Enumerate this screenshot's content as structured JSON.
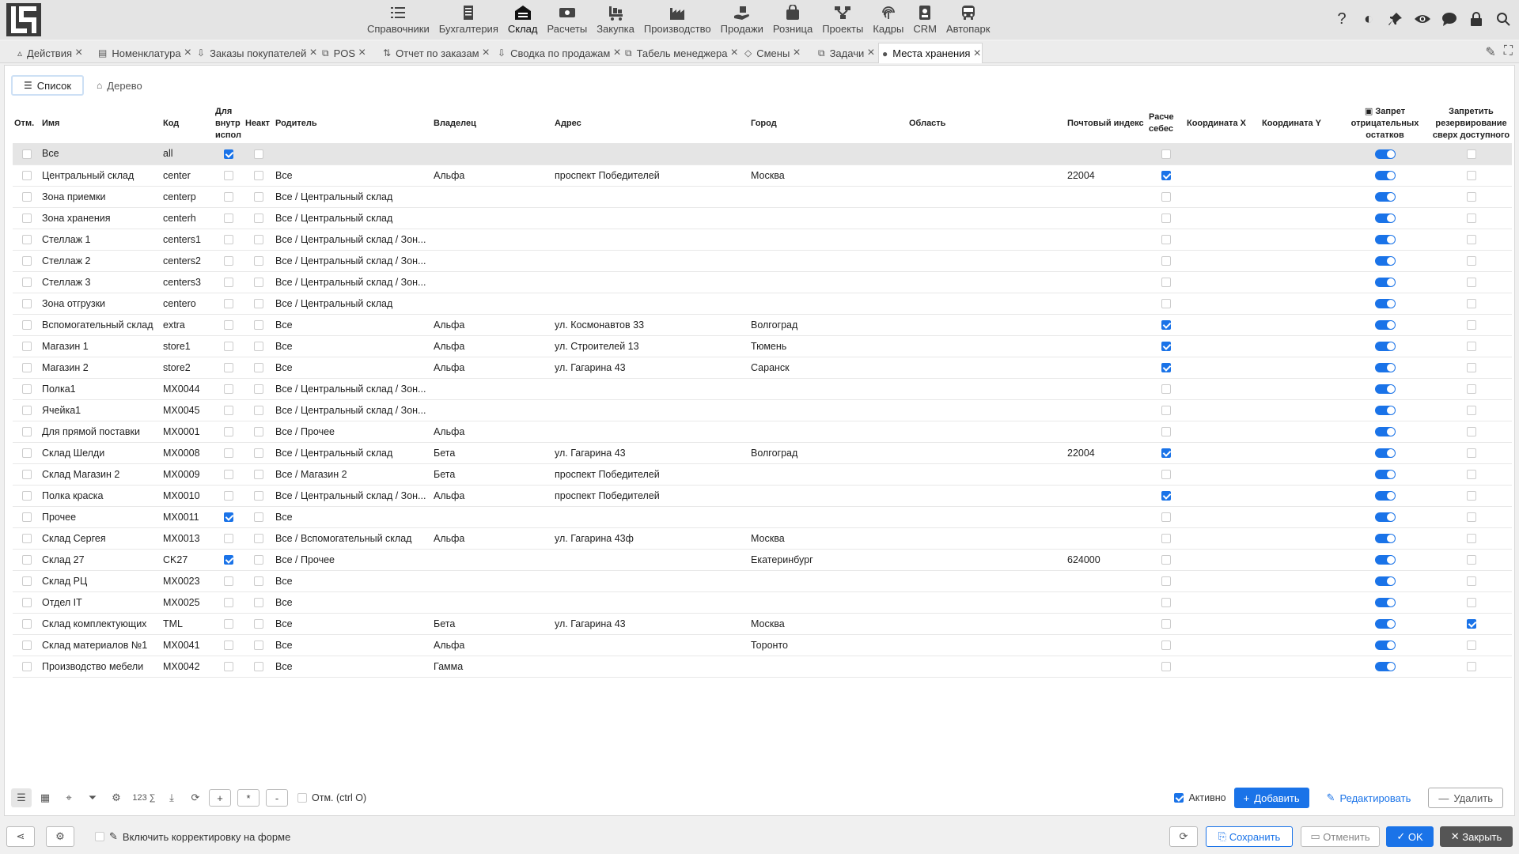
{
  "modules": [
    {
      "label": "Справочники",
      "icon": "list-icon"
    },
    {
      "label": "Бухгалтерия",
      "icon": "ledger-icon"
    },
    {
      "label": "Склад",
      "icon": "warehouse-icon",
      "active": true
    },
    {
      "label": "Расчеты",
      "icon": "money-icon"
    },
    {
      "label": "Закупка",
      "icon": "cart-icon"
    },
    {
      "label": "Производство",
      "icon": "factory-icon"
    },
    {
      "label": "Продажи",
      "icon": "hand-money-icon"
    },
    {
      "label": "Розница",
      "icon": "shopping-bag-icon"
    },
    {
      "label": "Проекты",
      "icon": "project-icon"
    },
    {
      "label": "Кадры",
      "icon": "fingerprint-icon"
    },
    {
      "label": "CRM",
      "icon": "contact-card-icon"
    },
    {
      "label": "Автопарк",
      "icon": "bus-icon"
    }
  ],
  "tabs": [
    {
      "label": "Действия"
    },
    {
      "label": "Номенклатура"
    },
    {
      "label": "Заказы покупателей"
    },
    {
      "label": "POS"
    },
    {
      "label": "Отчет по заказам"
    },
    {
      "label": "Сводка по продажам"
    },
    {
      "label": "Табель менеджера"
    },
    {
      "label": "Смены"
    },
    {
      "label": "Задачи"
    },
    {
      "label": "Места хранения",
      "active": true
    }
  ],
  "view_tabs": {
    "list": "Список",
    "tree": "Дерево"
  },
  "columns": {
    "mark": "Отм.",
    "name": "Имя",
    "code": "Код",
    "internal": "Для внутр испол",
    "inactive": "Неакт",
    "parent": "Родитель",
    "owner": "Владелец",
    "address": "Адрес",
    "city": "Город",
    "region": "Область",
    "postal": "Почтовый индекс",
    "cost": "Расче себес",
    "coordx": "Координата X",
    "coordy": "Координата Y",
    "negative": "Запрет отрицательных остатков",
    "reserve": "Запретить резервирование сверх доступного"
  },
  "rows": [
    {
      "name": "Все",
      "code": "all",
      "internal": true,
      "inactive": false,
      "parent": "",
      "owner": "",
      "address": "",
      "city": "",
      "postal": "",
      "cost": false,
      "reserve": false
    },
    {
      "name": "Центральный склад",
      "code": "center",
      "internal": false,
      "inactive": false,
      "parent": "Все",
      "owner": "Альфа",
      "address": "проспект Победителей",
      "city": "Москва",
      "postal": "22004",
      "cost": true,
      "reserve": false
    },
    {
      "name": "Зона приемки",
      "code": "centerp",
      "internal": false,
      "inactive": false,
      "parent": "Все / Центральный склад",
      "owner": "",
      "address": "",
      "city": "",
      "postal": "",
      "cost": false,
      "reserve": false
    },
    {
      "name": "Зона хранения",
      "code": "centerh",
      "internal": false,
      "inactive": false,
      "parent": "Все / Центральный склад",
      "owner": "",
      "address": "",
      "city": "",
      "postal": "",
      "cost": false,
      "reserve": false
    },
    {
      "name": "Стеллаж 1",
      "code": "centers1",
      "internal": false,
      "inactive": false,
      "parent": "Все / Центральный склад / Зон...",
      "owner": "",
      "address": "",
      "city": "",
      "postal": "",
      "cost": false,
      "reserve": false
    },
    {
      "name": "Стеллаж 2",
      "code": "centers2",
      "internal": false,
      "inactive": false,
      "parent": "Все / Центральный склад / Зон...",
      "owner": "",
      "address": "",
      "city": "",
      "postal": "",
      "cost": false,
      "reserve": false
    },
    {
      "name": "Стеллаж 3",
      "code": "centers3",
      "internal": false,
      "inactive": false,
      "parent": "Все / Центральный склад / Зон...",
      "owner": "",
      "address": "",
      "city": "",
      "postal": "",
      "cost": false,
      "reserve": false
    },
    {
      "name": "Зона отгрузки",
      "code": "centero",
      "internal": false,
      "inactive": false,
      "parent": "Все / Центральный склад",
      "owner": "",
      "address": "",
      "city": "",
      "postal": "",
      "cost": false,
      "reserve": false
    },
    {
      "name": "Вспомогательный склад",
      "code": "extra",
      "internal": false,
      "inactive": false,
      "parent": "Все",
      "owner": "Альфа",
      "address": "ул. Космонавтов 33",
      "city": "Волгоград",
      "postal": "",
      "cost": true,
      "reserve": false
    },
    {
      "name": "Магазин 1",
      "code": "store1",
      "internal": false,
      "inactive": false,
      "parent": "Все",
      "owner": "Альфа",
      "address": "ул. Строителей 13",
      "city": "Тюмень",
      "postal": "",
      "cost": true,
      "reserve": false
    },
    {
      "name": "Магазин 2",
      "code": "store2",
      "internal": false,
      "inactive": false,
      "parent": "Все",
      "owner": "Альфа",
      "address": "ул. Гагарина 43",
      "city": "Саранск",
      "postal": "",
      "cost": true,
      "reserve": false
    },
    {
      "name": "Полка1",
      "code": "MX0044",
      "internal": false,
      "inactive": false,
      "parent": "Все / Центральный склад / Зон...",
      "owner": "",
      "address": "",
      "city": "",
      "postal": "",
      "cost": false,
      "reserve": false
    },
    {
      "name": "Ячейка1",
      "code": "MX0045",
      "internal": false,
      "inactive": false,
      "parent": "Все / Центральный склад / Зон...",
      "owner": "",
      "address": "",
      "city": "",
      "postal": "",
      "cost": false,
      "reserve": false
    },
    {
      "name": "Для прямой поставки",
      "code": "MX0001",
      "internal": false,
      "inactive": false,
      "parent": "Все / Прочее",
      "owner": "Альфа",
      "address": "",
      "city": "",
      "postal": "",
      "cost": false,
      "reserve": false
    },
    {
      "name": "Склад Шелди",
      "code": "MX0008",
      "internal": false,
      "inactive": false,
      "parent": "Все / Центральный склад",
      "owner": "Бета",
      "address": "ул. Гагарина 43",
      "city": "Волгоград",
      "postal": "22004",
      "cost": true,
      "reserve": false
    },
    {
      "name": "Склад Магазин 2",
      "code": "MX0009",
      "internal": false,
      "inactive": false,
      "parent": "Все / Магазин 2",
      "owner": "Бета",
      "address": "проспект Победителей",
      "city": "",
      "postal": "",
      "cost": false,
      "reserve": false
    },
    {
      "name": "Полка краска",
      "code": "MX0010",
      "internal": false,
      "inactive": false,
      "parent": "Все / Центральный склад / Зон...",
      "owner": "Альфа",
      "address": "проспект Победителей",
      "city": "",
      "postal": "",
      "cost": true,
      "reserve": false
    },
    {
      "name": "Прочее",
      "code": "MX0011",
      "internal": true,
      "inactive": false,
      "parent": "Все",
      "owner": "",
      "address": "",
      "city": "",
      "postal": "",
      "cost": false,
      "reserve": false
    },
    {
      "name": "Склад Сергея",
      "code": "MX0013",
      "internal": false,
      "inactive": false,
      "parent": "Все / Вспомогательный склад",
      "owner": "Альфа",
      "address": "ул. Гагарина 43ф",
      "city": "Москва",
      "postal": "",
      "cost": false,
      "reserve": false
    },
    {
      "name": "Склад 27",
      "code": "CK27",
      "internal": true,
      "inactive": false,
      "parent": "Все / Прочее",
      "owner": "",
      "address": "",
      "city": "Екатеринбург",
      "postal": "624000",
      "cost": false,
      "reserve": false
    },
    {
      "name": "Склад РЦ",
      "code": "MX0023",
      "internal": false,
      "inactive": false,
      "parent": "Все",
      "owner": "",
      "address": "",
      "city": "",
      "postal": "",
      "cost": false,
      "reserve": false
    },
    {
      "name": "Отдел IT",
      "code": "MX0025",
      "internal": false,
      "inactive": false,
      "parent": "Все",
      "owner": "",
      "address": "",
      "city": "",
      "postal": "",
      "cost": false,
      "reserve": false
    },
    {
      "name": "Склад комплектующих",
      "code": "TML",
      "internal": false,
      "inactive": false,
      "parent": "Все",
      "owner": "Бета",
      "address": "ул. Гагарина 43",
      "city": "Москва",
      "postal": "",
      "cost": false,
      "reserve": true
    },
    {
      "name": "Склад материалов №1",
      "code": "MX0041",
      "internal": false,
      "inactive": false,
      "parent": "Все",
      "owner": "Альфа",
      "address": "",
      "city": "Торонто",
      "postal": "",
      "cost": false,
      "reserve": false
    },
    {
      "name": "Производство мебели",
      "code": "MX0042",
      "internal": false,
      "inactive": false,
      "parent": "Все",
      "owner": "Гамма",
      "address": "",
      "city": "",
      "postal": "",
      "cost": false,
      "reserve": false
    }
  ],
  "gridbar": {
    "count_label": "123",
    "sum_label": "∑",
    "add_small": "+",
    "star_small": "*",
    "minus_small": "-",
    "mark_label": "Отм. (ctrl O)",
    "active_label": "Активно",
    "add_label": "Добавить",
    "edit_label": "Редактировать",
    "delete_label": "Удалить"
  },
  "footer": {
    "edit_on_form": "Включить корректировку на форме",
    "save": "Сохранить",
    "cancel": "Отменить",
    "ok": "OK",
    "close": "Закрыть"
  },
  "colors": {
    "accent": "#1a73e8"
  }
}
